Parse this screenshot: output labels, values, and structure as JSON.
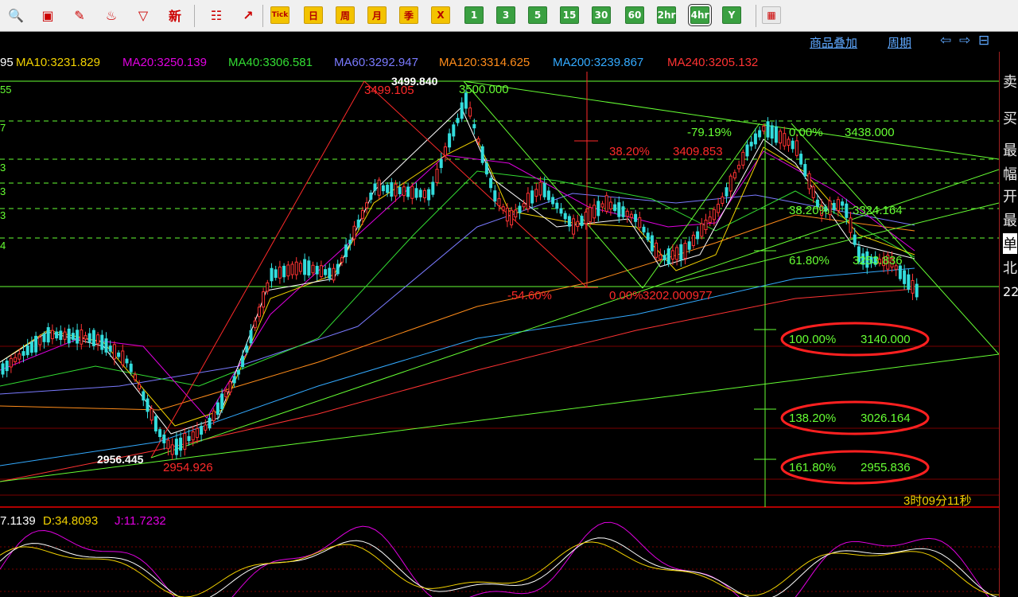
{
  "toolbar": {
    "buttons": [
      {
        "name": "search-icon",
        "label": "",
        "style": "icon",
        "glyph": "🔍"
      },
      {
        "name": "window-icon",
        "label": "",
        "style": "icon",
        "glyph": "▣"
      },
      {
        "name": "pen-icon",
        "label": "",
        "style": "icon",
        "glyph": "✎"
      },
      {
        "name": "flame-icon",
        "label": "",
        "style": "icon",
        "glyph": "♨"
      },
      {
        "name": "filter-icon",
        "label": "",
        "style": "icon",
        "glyph": "▽"
      },
      {
        "name": "new-icon",
        "label": "新",
        "style": "plain"
      },
      {
        "name": "table-icon",
        "label": "",
        "style": "icon",
        "glyph": "☷"
      },
      {
        "name": "trend-icon",
        "label": "",
        "style": "icon",
        "glyph": "↗"
      },
      {
        "name": "tick-button",
        "label": "Tick",
        "style": "yellow"
      },
      {
        "name": "day-button",
        "label": "日",
        "style": "yellow"
      },
      {
        "name": "week-button",
        "label": "周",
        "style": "yellow"
      },
      {
        "name": "month-button",
        "label": "月",
        "style": "yellow"
      },
      {
        "name": "season-button",
        "label": "季",
        "style": "yellow"
      },
      {
        "name": "custom-period-button",
        "label": "X",
        "style": "yellow"
      },
      {
        "name": "period-1min-button",
        "label": "1",
        "style": "green"
      },
      {
        "name": "period-3min-button",
        "label": "3",
        "style": "green"
      },
      {
        "name": "period-5min-button",
        "label": "5",
        "style": "green"
      },
      {
        "name": "period-15min-button",
        "label": "15",
        "style": "green"
      },
      {
        "name": "period-30min-button",
        "label": "30",
        "style": "green"
      },
      {
        "name": "period-60min-button",
        "label": "60",
        "style": "green"
      },
      {
        "name": "period-2hr-button",
        "label": "2hr",
        "style": "green"
      },
      {
        "name": "period-4hr-button",
        "label": "4hr",
        "style": "green",
        "selected": true
      },
      {
        "name": "period-year-button",
        "label": "Y",
        "style": "green"
      },
      {
        "name": "grid-view-icon",
        "label": "",
        "style": "red",
        "glyph": "▦"
      }
    ]
  },
  "subbar": {
    "overlay_label": "商品叠加",
    "period_label": "周期",
    "nav_glyphs": [
      "⇦",
      "⇨",
      "⊟"
    ]
  },
  "right_panel": {
    "chars": [
      "卖",
      "买",
      "最",
      "幅",
      "开",
      "最",
      "单",
      "北",
      "22"
    ]
  },
  "ma_line": {
    "items": [
      {
        "text": "95",
        "color": "#ffffff"
      },
      {
        "text": "MA10:3231.829",
        "color": "#f2d200"
      },
      {
        "text": "MA20:3250.139",
        "color": "#e000e0"
      },
      {
        "text": "MA40:3306.581",
        "color": "#33dd33"
      },
      {
        "text": "MA60:3292.947",
        "color": "#7a7aff"
      },
      {
        "text": "MA120:3314.625",
        "color": "#ff8c1a"
      },
      {
        "text": "MA200:3239.867",
        "color": "#33aaff"
      },
      {
        "text": "MA240:3205.132",
        "color": "#ff3333"
      }
    ]
  },
  "kdj_line": {
    "items": [
      {
        "text": "7.1139",
        "color": "#ffffff"
      },
      {
        "text": "D:34.8093",
        "color": "#f2d200"
      },
      {
        "text": "J:11.7232",
        "color": "#e000e0"
      }
    ]
  },
  "left_axis_labels": [
    "55",
    "7",
    "3",
    "3",
    "3",
    "4"
  ],
  "price_labels": {
    "peak_white": "3499.840",
    "peak_red": "3499.105",
    "peak_green": "3500.000",
    "low_white": "2956.445",
    "low_red": "2954.926",
    "low_mid": "3202.000977"
  },
  "fib_labels": {
    "pct_neg7919": "-79.19%",
    "pct_0": "0.00%",
    "val_3438": "3438.000",
    "pct_3820_red": "38.20%",
    "val_3409": "3409.853",
    "pct_neg5460": "-54.60%",
    "pct_0_mid": "0.00%",
    "pct_3820_green": "38.20%",
    "val_3324": "3324.164",
    "pct_6180": "61.80%",
    "val_3253": "3253.836",
    "pct_100": "100.00%",
    "val_3140": "3140.000",
    "pct_13820": "138.20%",
    "val_3026": "3026.164",
    "pct_16180": "161.80%",
    "val_2955": "2955.836"
  },
  "timer": "3时09分11秒",
  "colors": {
    "up": "#ff3333",
    "down": "#33dddd",
    "grid": "#8b0000",
    "fib": "#66ff33",
    "accent_oval": "#ff2020"
  }
}
